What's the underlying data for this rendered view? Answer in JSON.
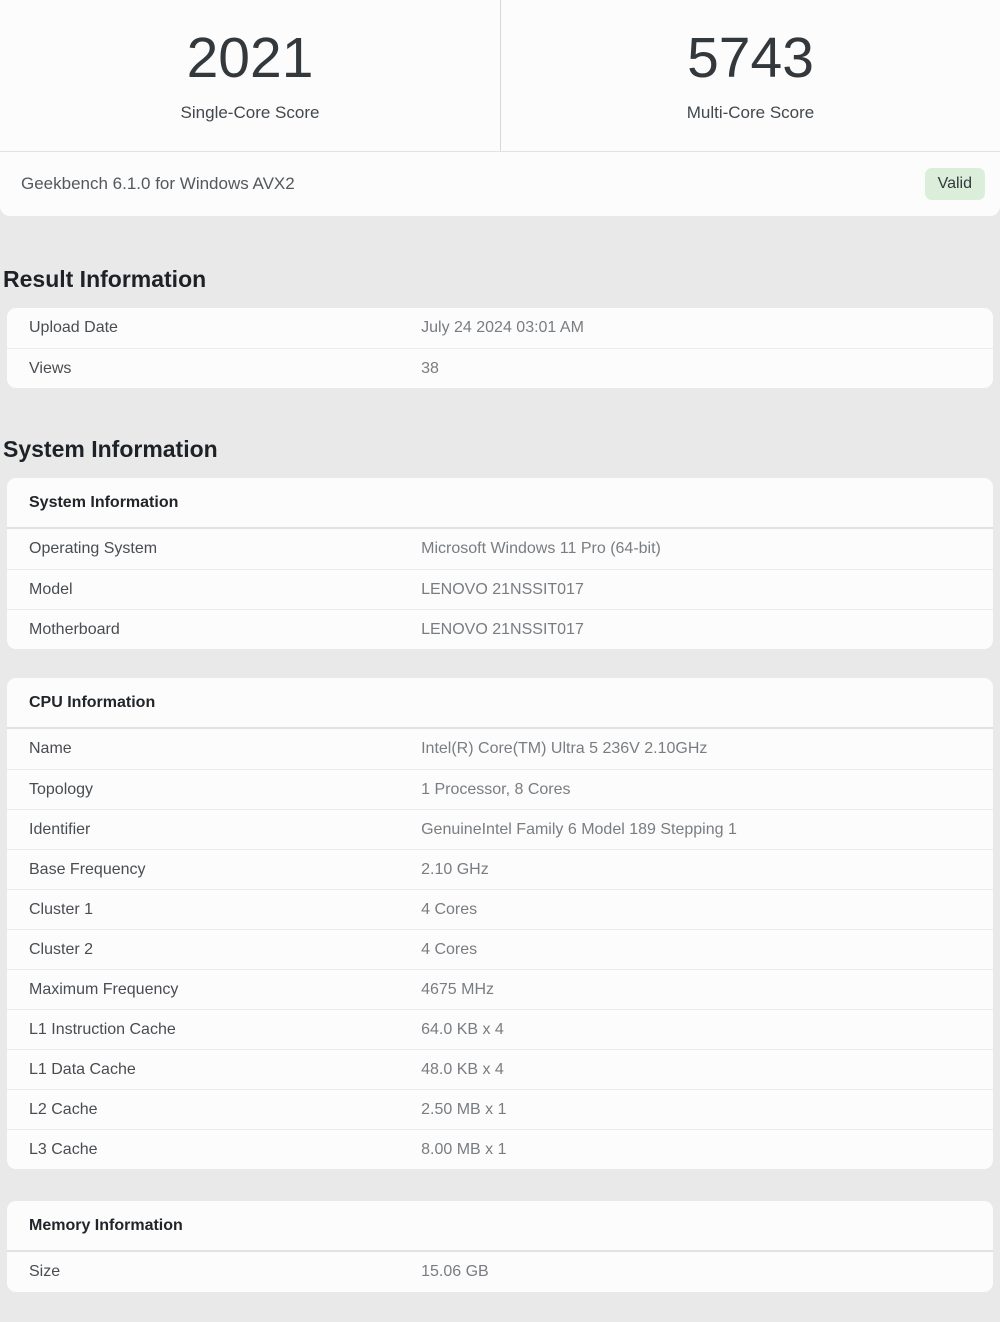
{
  "scores": {
    "single_core": {
      "value": "2021",
      "label": "Single-Core Score"
    },
    "multi_core": {
      "value": "5743",
      "label": "Multi-Core Score"
    }
  },
  "version_bar": {
    "text": "Geekbench 6.1.0 for Windows AVX2",
    "badge_label": "Valid"
  },
  "colors": {
    "badge_bg": "#daeeda",
    "badge_text": "#32383e",
    "page_bg": "#e9e9e9",
    "card_bg": "#fcfcfc"
  },
  "result_information": {
    "heading": "Result Information",
    "rows": [
      {
        "label": "Upload Date",
        "value": "July 24 2024 03:01 AM"
      },
      {
        "label": "Views",
        "value": "38"
      }
    ]
  },
  "system_information": {
    "heading": "System Information",
    "table_header": "System Information",
    "rows": [
      {
        "label": "Operating System",
        "value": "Microsoft Windows 11 Pro (64-bit)"
      },
      {
        "label": "Model",
        "value": "LENOVO 21NSSIT017"
      },
      {
        "label": "Motherboard",
        "value": "LENOVO 21NSSIT017"
      }
    ]
  },
  "cpu_information": {
    "table_header": "CPU Information",
    "rows": [
      {
        "label": "Name",
        "value": "Intel(R) Core(TM) Ultra 5 236V 2.10GHz"
      },
      {
        "label": "Topology",
        "value": "1 Processor, 8 Cores"
      },
      {
        "label": "Identifier",
        "value": "GenuineIntel Family 6 Model 189 Stepping 1"
      },
      {
        "label": "Base Frequency",
        "value": "2.10 GHz"
      },
      {
        "label": "Cluster 1",
        "value": "4 Cores"
      },
      {
        "label": "Cluster 2",
        "value": "4 Cores"
      },
      {
        "label": "Maximum Frequency",
        "value": "4675 MHz"
      },
      {
        "label": "L1 Instruction Cache",
        "value": "64.0 KB x 4"
      },
      {
        "label": "L1 Data Cache",
        "value": "48.0 KB x 4"
      },
      {
        "label": "L2 Cache",
        "value": "2.50 MB x 1"
      },
      {
        "label": "L3 Cache",
        "value": "8.00 MB x 1"
      }
    ]
  },
  "memory_information": {
    "table_header": "Memory Information",
    "rows": [
      {
        "label": "Size",
        "value": "15.06 GB"
      }
    ]
  }
}
